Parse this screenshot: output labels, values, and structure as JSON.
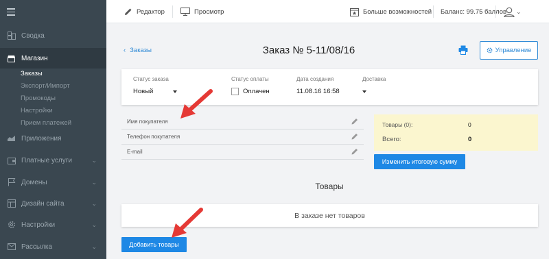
{
  "sidebar": {
    "items": [
      {
        "label": "Сводка",
        "icon": "dashboard-icon",
        "has_chevron": false
      },
      {
        "label": "Магазин",
        "icon": "shop-icon",
        "has_chevron": false,
        "active": true
      },
      {
        "label": "Приложения",
        "icon": "apps-icon",
        "has_chevron": false
      },
      {
        "label": "Платные услуги",
        "icon": "wallet-icon",
        "has_chevron": true
      },
      {
        "label": "Домены",
        "icon": "flag-icon",
        "has_chevron": true
      },
      {
        "label": "Дизайн сайта",
        "icon": "layout-icon",
        "has_chevron": true
      },
      {
        "label": "Настройки",
        "icon": "gear-icon",
        "has_chevron": true
      },
      {
        "label": "Рассылка",
        "icon": "mail-icon",
        "has_chevron": true
      }
    ],
    "shop_subitems": [
      {
        "label": "Заказы",
        "active": true
      },
      {
        "label": "Экспорт/Импорт"
      },
      {
        "label": "Промокоды"
      },
      {
        "label": "Настройки"
      },
      {
        "label": "Прием платежей"
      }
    ]
  },
  "topbar": {
    "editor": "Редактор",
    "preview": "Просмотр",
    "more": "Больше возможностей",
    "balance": "Баланс: 99.75 баллов"
  },
  "order": {
    "back_label": "Заказы",
    "title": "Заказ № 5-11/08/16",
    "manage_label": "Управление",
    "status": {
      "order_status_label": "Статус заказа",
      "order_status_value": "Новый",
      "payment_status_label": "Статус оплаты",
      "payment_status_value": "Оплачен",
      "created_label": "Дата создания",
      "created_value": "11.08.16 16:58",
      "delivery_label": "Доставка"
    },
    "buyer_fields": [
      {
        "label": "Имя покупателя"
      },
      {
        "label": "Телефон покупателя"
      },
      {
        "label": "E-mail"
      }
    ],
    "totals": {
      "items_label": "Товары (0):",
      "items_value": "0",
      "total_label": "Всего:",
      "total_value": "0"
    },
    "change_total_label": "Изменить итоговую сумму",
    "goods_title": "Товары",
    "empty_text": "В заказе нет товаров",
    "add_goods_label": "Добавить товары"
  },
  "colors": {
    "sidebar_bg": "#3a4750",
    "accent": "#1e88e5",
    "totals_bg": "#fbf6cf",
    "annotation_arrow": "#e53935"
  }
}
